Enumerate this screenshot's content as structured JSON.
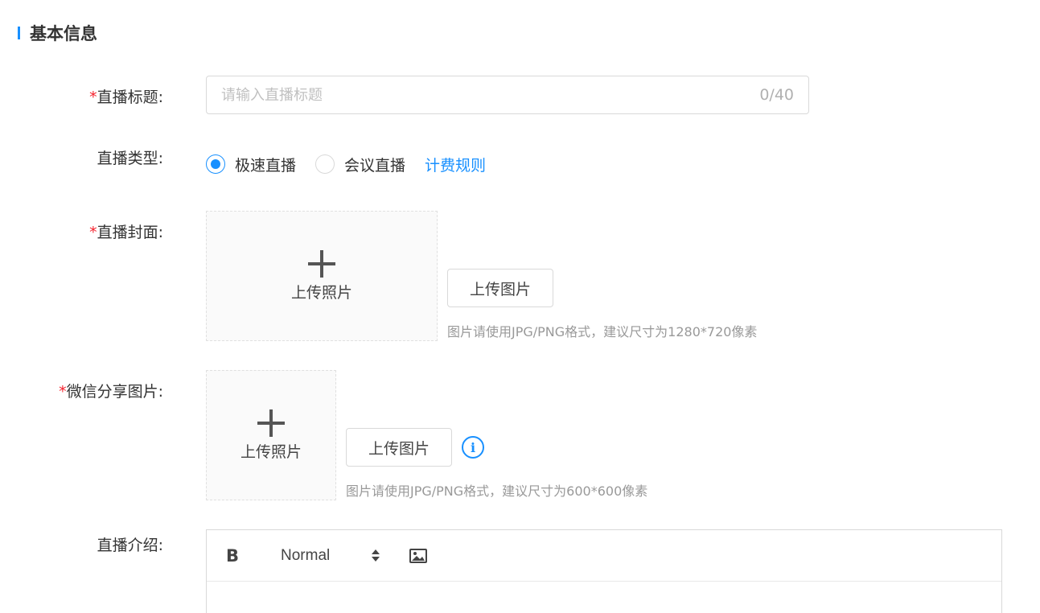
{
  "section": {
    "title": "基本信息"
  },
  "form": {
    "title": {
      "required_mark": "*",
      "label": "直播标题:",
      "placeholder": "请输入直播标题",
      "value": "",
      "counter": "0/40"
    },
    "type": {
      "label": "直播类型:",
      "options": [
        {
          "label": "极速直播",
          "checked": true
        },
        {
          "label": "会议直播",
          "checked": false
        }
      ],
      "link": "计费规则"
    },
    "cover": {
      "required_mark": "*",
      "label": "直播封面:",
      "upload_box_text": "上传照片",
      "upload_button": "上传图片",
      "hint": "图片请使用JPG/PNG格式，建议尺寸为1280*720像素"
    },
    "wechat_share": {
      "required_mark": "*",
      "label": "微信分享图片:",
      "upload_box_text": "上传照片",
      "upload_button": "上传图片",
      "info_icon": "info-icon",
      "info_glyph": "i",
      "hint": "图片请使用JPG/PNG格式，建议尺寸为600*600像素"
    },
    "intro": {
      "label": "直播介绍:",
      "toolbar": {
        "bold": "B",
        "header_select": "Normal",
        "image_icon": "image-icon"
      }
    }
  },
  "colors": {
    "accent": "#1890ff",
    "required": "#f5222d",
    "border": "#d9d9d9",
    "hint": "#999999"
  }
}
